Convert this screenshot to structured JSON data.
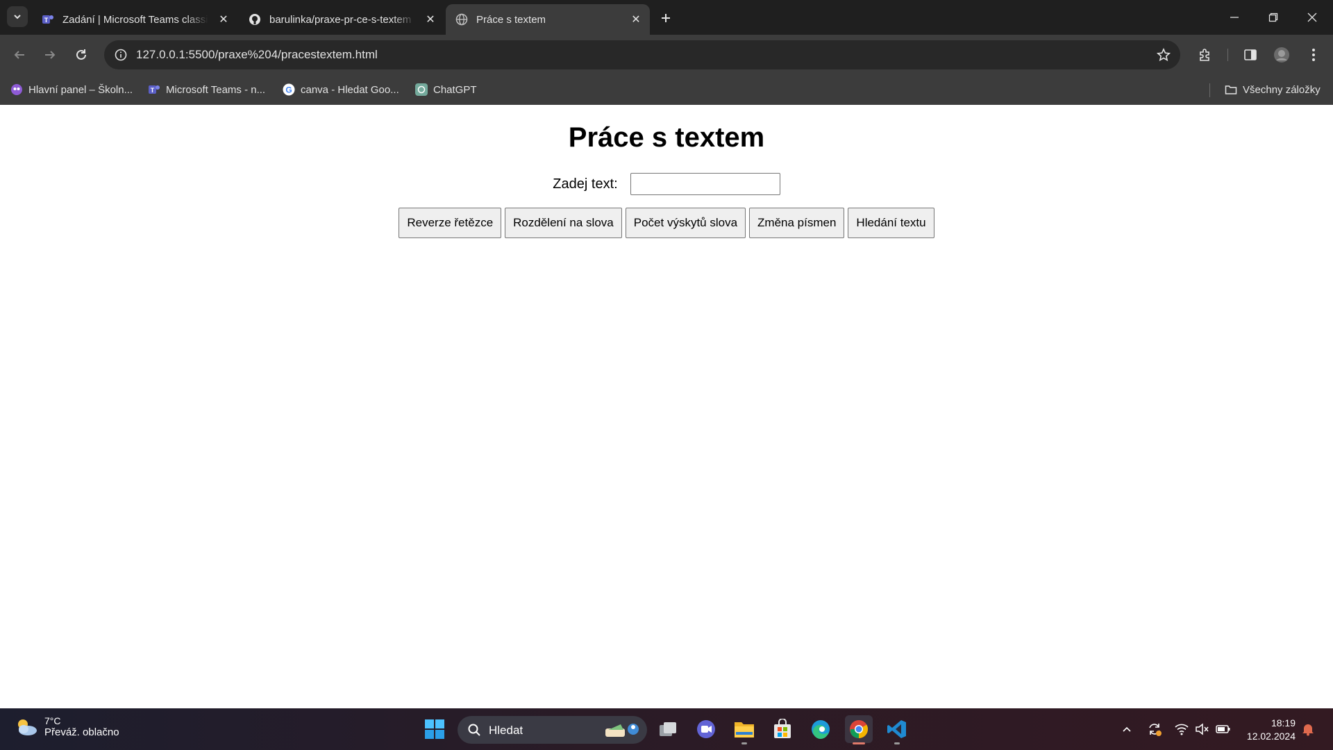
{
  "browser": {
    "tabs": [
      {
        "title": "Zadání | Microsoft Teams classic",
        "favicon": "teams-icon",
        "active": false
      },
      {
        "title": "barulinka/praxe-pr-ce-s-textem",
        "favicon": "github-icon",
        "active": false
      },
      {
        "title": "Práce s textem",
        "favicon": "globe-icon",
        "active": true
      }
    ],
    "url": "127.0.0.1:5500/praxe%204/pracestextem.html",
    "bookmarks": [
      {
        "label": "Hlavní panel – Školn...",
        "icon": "school-icon"
      },
      {
        "label": "Microsoft Teams - n...",
        "icon": "teams-icon"
      },
      {
        "label": "canva - Hledat Goo...",
        "icon": "google-icon"
      },
      {
        "label": "ChatGPT",
        "icon": "chatgpt-icon"
      }
    ],
    "all_bookmarks_label": "Všechny záložky"
  },
  "page": {
    "heading": "Práce s textem",
    "input_label": "Zadej text:",
    "input_value": "",
    "buttons": [
      "Reverze řetězce",
      "Rozdělení na slova",
      "Počet výskytů slova",
      "Změna písmen",
      "Hledání textu"
    ]
  },
  "taskbar": {
    "weather_temp": "7°C",
    "weather_desc": "Převáž. oblačno",
    "search_label": "Hledat",
    "time": "18:19",
    "date": "12.02.2024"
  }
}
